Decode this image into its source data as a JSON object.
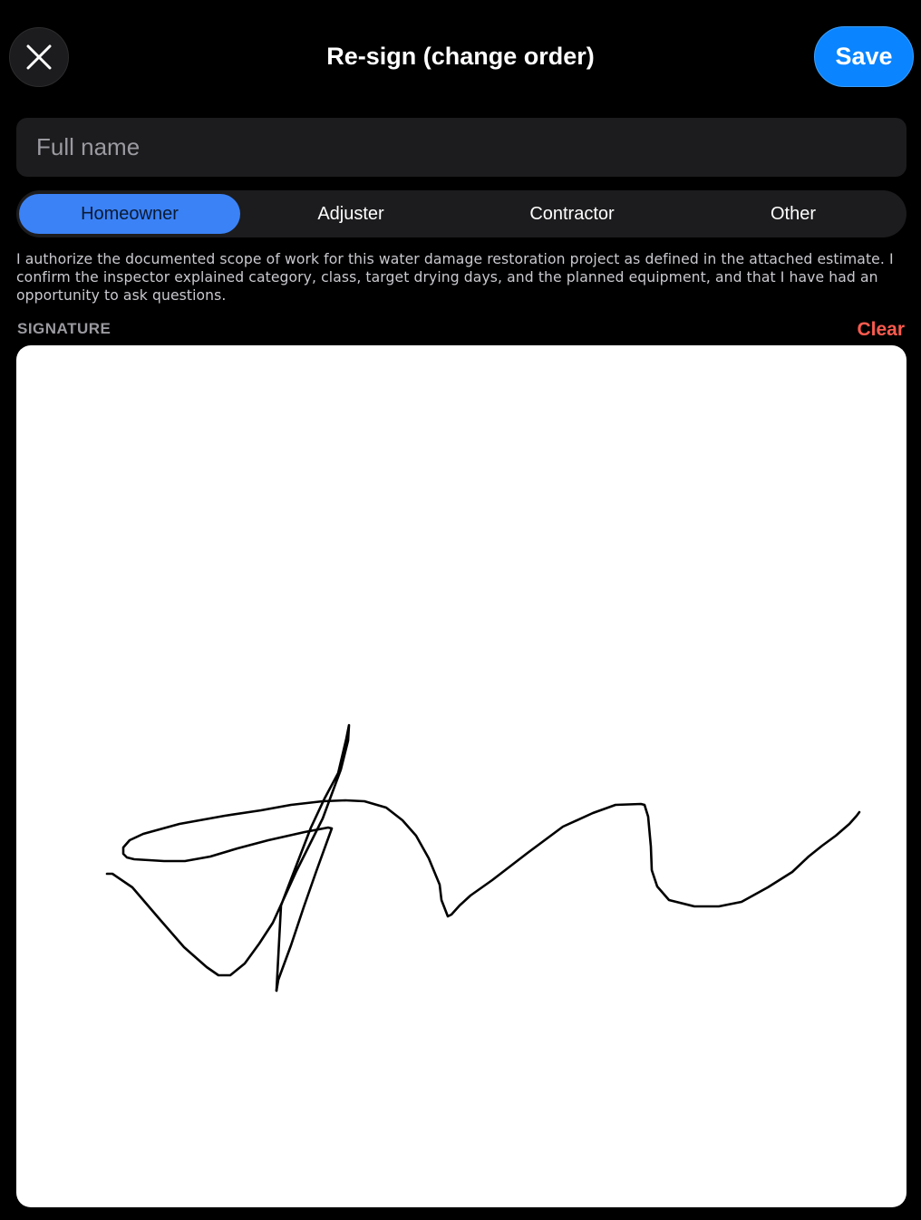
{
  "header": {
    "title": "Re-sign (change order)",
    "close_icon": "close-icon",
    "save_label": "Save"
  },
  "name_field": {
    "placeholder": "Full name",
    "value": ""
  },
  "role_selector": {
    "options": [
      "Homeowner",
      "Adjuster",
      "Contractor",
      "Other"
    ],
    "selected": "Homeowner"
  },
  "authorization_text": "I authorize the documented scope of work for this water damage restoration project as defined in the attached estimate. I confirm the inspector explained category, class, target drying days, and the planned equipment, and that I have had an opportunity to ask questions.",
  "signature": {
    "label": "SIGNATURE",
    "clear_label": "Clear"
  },
  "colors": {
    "background": "#000000",
    "accent": "#0a84ff",
    "segment_active": "#3b82f6",
    "destructive": "#ff5b4f",
    "field_bg": "#1c1c1e"
  }
}
